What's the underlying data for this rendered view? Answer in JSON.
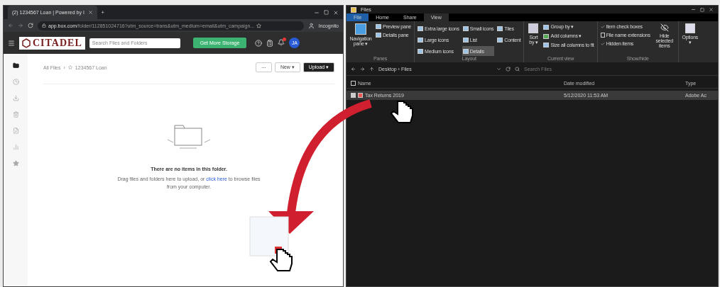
{
  "browser": {
    "tab_title": "(2) 1234567 Loan | Powered by I",
    "new_tab": "+",
    "url_host": "app.box.com",
    "url_path": "/folder/112851024716?utm_source=trans&utm_medium=email&utm_campaign...",
    "profile": "Incognito"
  },
  "box": {
    "logo": "CITADEL",
    "search_placeholder": "Search Files and Folders",
    "storage_button": "Get More Storage",
    "avatar": "JA",
    "notification_badge": true,
    "breadcrumb": [
      {
        "label": "All Files"
      },
      {
        "label": "1234567 Loan"
      }
    ],
    "breadcrumb_separator": "›",
    "more_button": "···",
    "new_button": "New ▾",
    "upload_button": "Upload ▾",
    "sidebar": [
      {
        "kind": "folder",
        "selected": true
      },
      {
        "kind": "clock",
        "selected": false
      },
      {
        "kind": "download",
        "selected": false
      },
      {
        "kind": "trash",
        "selected": false
      },
      {
        "kind": "notes",
        "selected": false
      },
      {
        "kind": "chart",
        "selected": false
      },
      {
        "kind": "star",
        "selected": false
      }
    ],
    "empty_title": "There are no items in this folder.",
    "empty_text": "Drag files and folders here to upload, or **click here** to browse files from your computer."
  },
  "explorer": {
    "title": "Files",
    "tabs": [
      {
        "label": "File",
        "selected": false,
        "kind": "file"
      },
      {
        "label": "Home",
        "selected": false,
        "kind": "plain"
      },
      {
        "label": "Share",
        "selected": false,
        "kind": "plain"
      },
      {
        "label": "View",
        "selected": true,
        "kind": "plain"
      }
    ],
    "panes": {
      "navigation": "Navigation pane ▾",
      "preview": "Preview pane",
      "details": "Details pane",
      "label": "Panes"
    },
    "layout": {
      "options": [
        {
          "label": "Extra large icons",
          "selected": false
        },
        {
          "label": "Large icons",
          "selected": false
        },
        {
          "label": "Medium icons",
          "selected": false
        },
        {
          "label": "Small icons",
          "selected": false
        },
        {
          "label": "List",
          "selected": false
        },
        {
          "label": "Details",
          "selected": true
        },
        {
          "label": "Tiles",
          "selected": false
        },
        {
          "label": "Content",
          "selected": false
        }
      ],
      "label": "Layout"
    },
    "current_view": {
      "sort": "Sort by ▾",
      "items": [
        "Group by ▾",
        "Add columns ▾",
        "Size all columns to fit"
      ],
      "label": "Current view"
    },
    "show_hide": {
      "checks": [
        {
          "label": "Item check boxes",
          "checked": true
        },
        {
          "label": "File name extensions",
          "checked": false
        },
        {
          "label": "Hidden items",
          "checked": true
        }
      ],
      "hide_selected": "Hide selected items",
      "label": "Show/hide"
    },
    "options": "Options ▾",
    "path": "Desktop › Files",
    "search_placeholder": "Search Files",
    "columns": [
      "Name",
      "Date modified",
      "Type"
    ],
    "select_all_checked": false,
    "rows": [
      {
        "name": "Tax Returns 2019",
        "date": "5/12/2020 11:53 AM",
        "type": "Adobe Ac",
        "selected": true
      }
    ]
  }
}
